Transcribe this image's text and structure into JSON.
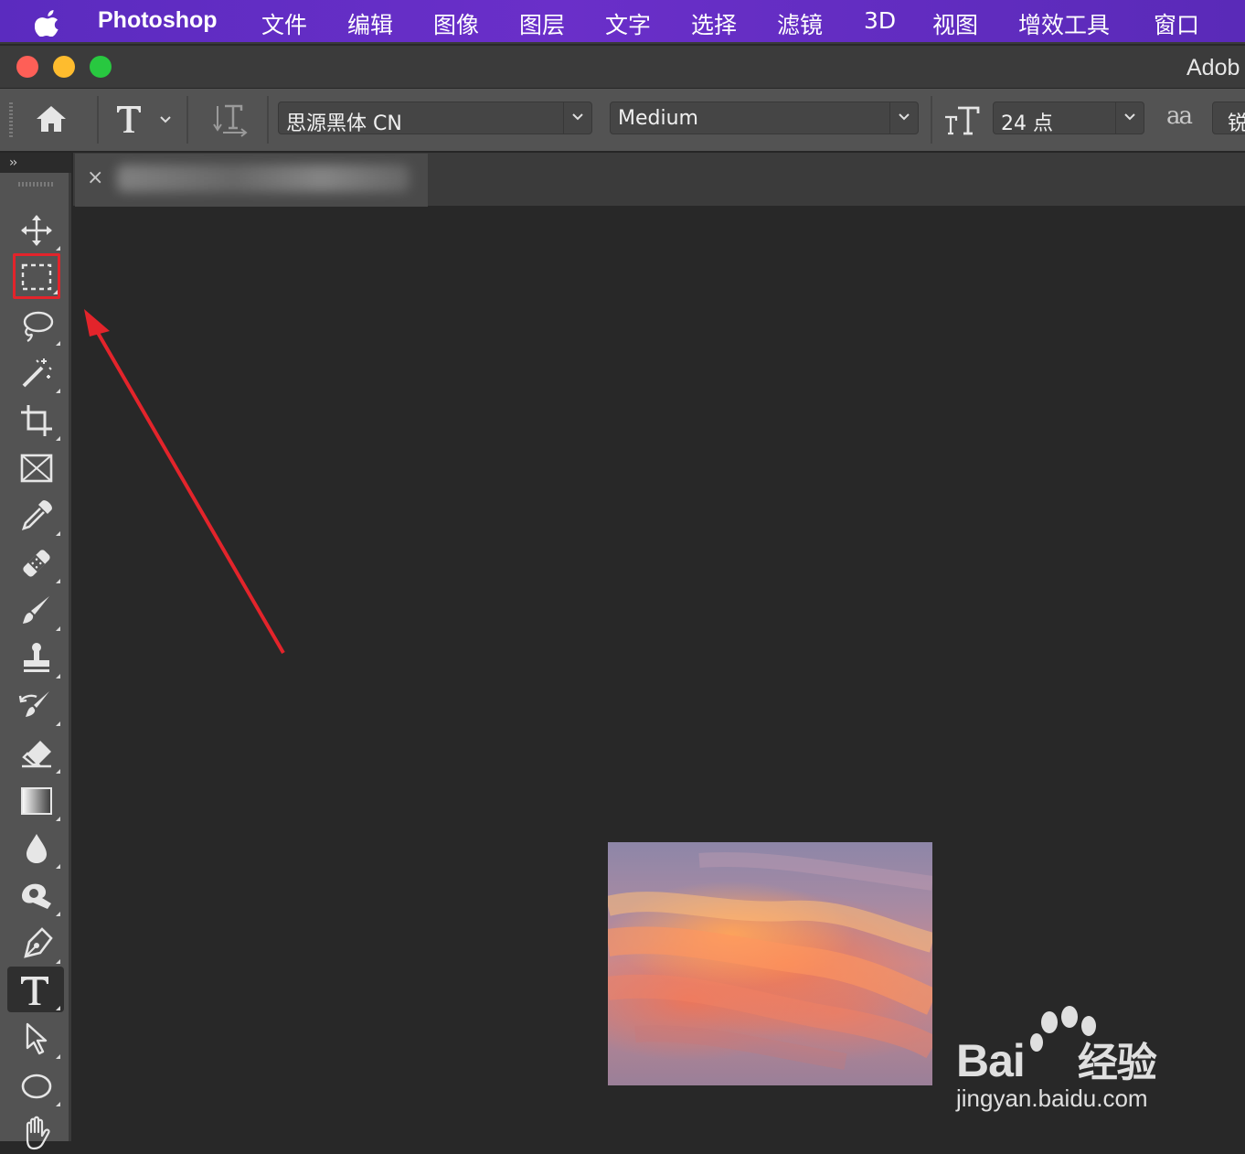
{
  "menubar": {
    "app_name": "Photoshop",
    "items": [
      "文件",
      "编辑",
      "图像",
      "图层",
      "文字",
      "选择",
      "滤镜",
      "3D",
      "视图",
      "增效工具",
      "窗口"
    ]
  },
  "window": {
    "title": "Adob"
  },
  "options_bar": {
    "font_family": "思源黑体 CN",
    "font_style": "Medium",
    "font_size": "24 点",
    "anti_alias_icon_text": "aa",
    "anti_alias_partial": "锐"
  },
  "document": {
    "tab_close": "×"
  },
  "toolbox": {
    "collapse_label": "››",
    "tools": [
      "move",
      "rectangular-marquee",
      "lasso",
      "magic-wand",
      "crop",
      "frame",
      "eyedropper",
      "healing-brush",
      "brush",
      "clone-stamp",
      "history-brush",
      "eraser",
      "gradient",
      "blur",
      "dodge",
      "pen",
      "type",
      "path-selection",
      "ellipse",
      "hand"
    ],
    "active_tool": "type",
    "highlighted_tool": "rectangular-marquee"
  },
  "colors": {
    "menubar": "#6a2fc9",
    "highlight": "#e3242b",
    "panel": "#535353",
    "canvas": "#282828"
  },
  "watermark": {
    "brand_latin": "Bai",
    "brand_cn": "经验",
    "url": "jingyan.baidu.com"
  }
}
